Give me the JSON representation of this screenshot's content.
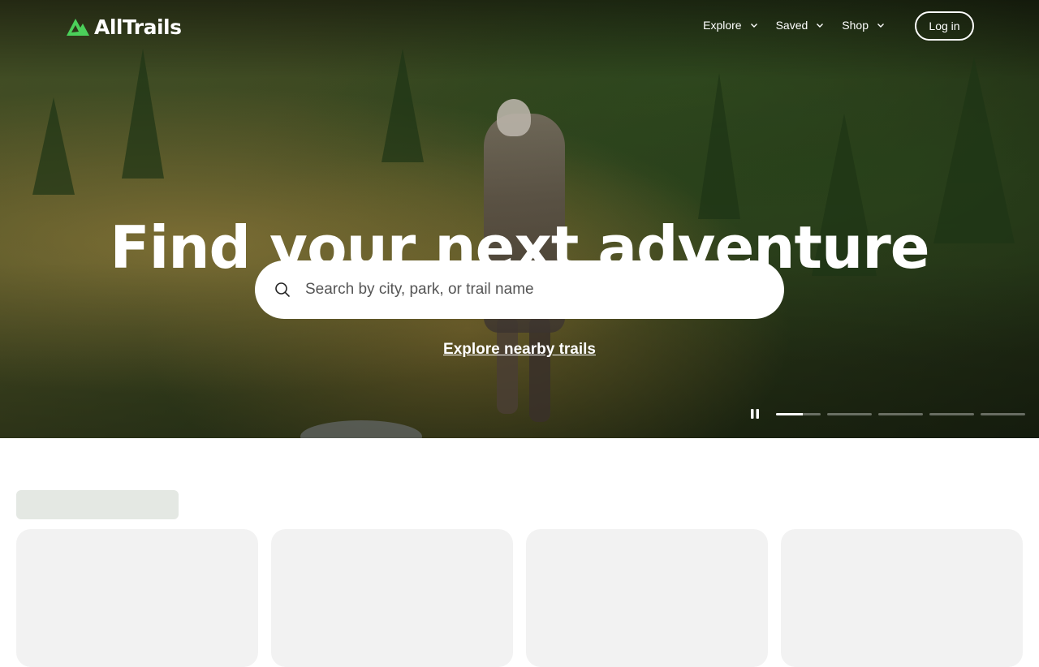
{
  "brand": {
    "name": "AllTrails",
    "accent": "#4bd05a"
  },
  "nav": {
    "items": [
      {
        "label": "Explore",
        "icon": "chevron-down-icon"
      },
      {
        "label": "Saved",
        "icon": "chevron-down-icon"
      },
      {
        "label": "Shop",
        "icon": "chevron-down-icon"
      }
    ],
    "login_label": "Log in"
  },
  "hero": {
    "headline": "Find your next adventure",
    "search": {
      "placeholder": "Search by city, park, or trail name",
      "value": "",
      "icon": "search-icon"
    },
    "explore_link": "Explore nearby trails",
    "carousel": {
      "pause_icon": "pause-icon",
      "slide_progress": [
        0.6,
        0,
        0,
        0,
        0
      ]
    }
  },
  "content": {
    "loading_cards": 4
  }
}
